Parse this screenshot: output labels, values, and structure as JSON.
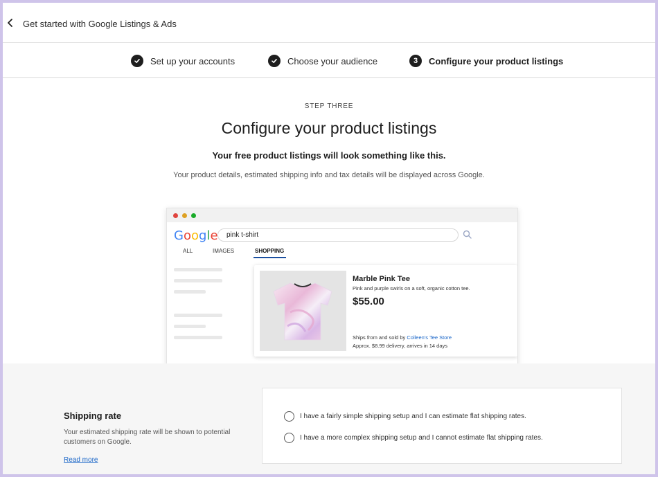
{
  "header": {
    "back_icon": "chevron-left-icon",
    "title": "Get started with Google Listings & Ads"
  },
  "stepper": {
    "steps": [
      {
        "label": "Set up your accounts",
        "icon": "check-circle-icon",
        "state": "complete"
      },
      {
        "label": "Choose your audience",
        "icon": "check-circle-icon",
        "state": "complete"
      },
      {
        "label": "Configure your product listings",
        "number": "3",
        "state": "active"
      }
    ]
  },
  "main": {
    "kicker": "STEP THREE",
    "title": "Configure your product listings",
    "subtitle": "Your free product listings will look something like this.",
    "description": "Your product details, estimated shipping info and tax details will be displayed across Google."
  },
  "preview": {
    "logo": "Google",
    "search_query": "pink t-shirt",
    "tabs": [
      "ALL",
      "IMAGES",
      "SHOPPING"
    ],
    "active_tab": "SHOPPING",
    "product": {
      "name": "Marble Pink Tee",
      "description": "Pink and purple swirls on a soft, organic cotton tee.",
      "price": "$55.00",
      "ships_prefix": "Ships from and sold by ",
      "store": "Colleen's Tee Store",
      "delivery": "Approx. $8.99 delivery, arrives in 14 days"
    }
  },
  "shipping": {
    "title": "Shipping rate",
    "description": "Your estimated shipping rate will be shown to potential customers on Google.",
    "read_more": "Read more",
    "options": [
      {
        "label": "I have a fairly simple shipping setup and I can estimate flat shipping rates.",
        "selected": false
      },
      {
        "label": "I have a more complex shipping setup and I cannot estimate flat shipping rates.",
        "selected": false
      }
    ]
  },
  "colors": {
    "frame_border": "#cfc4ea",
    "link": "#1a66c8",
    "shopping_underline": "#1a4fa0",
    "traffic_red": "#e0443e",
    "traffic_yellow": "#dea123",
    "traffic_green": "#1aab29"
  }
}
